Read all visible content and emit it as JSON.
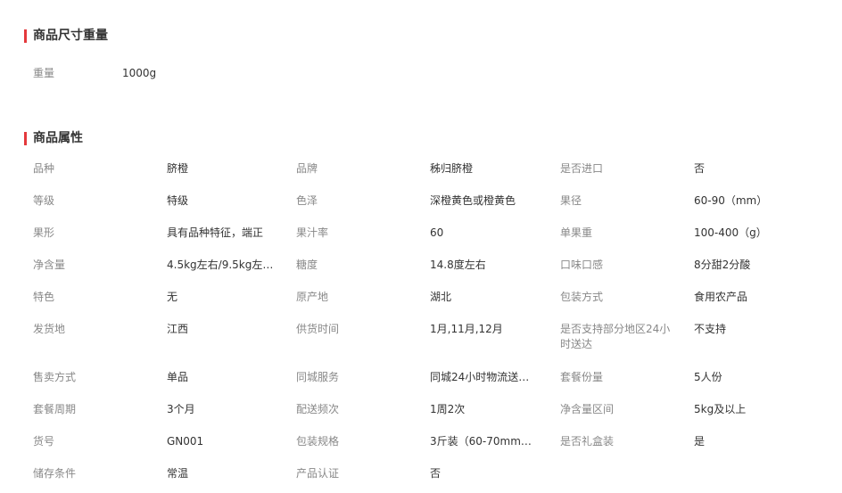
{
  "size_weight_section": {
    "title": "商品尺寸重量",
    "weight_label": "重量",
    "weight_value": "1000g"
  },
  "attributes_section": {
    "title": "商品属性",
    "rows": [
      [
        [
          "品种",
          "脐橙"
        ],
        [
          "品牌",
          "秭归脐橙"
        ],
        [
          "是否进口",
          "否"
        ]
      ],
      [
        [
          "等级",
          "特级"
        ],
        [
          "色泽",
          "深橙黄色或橙黄色"
        ],
        [
          "果径",
          "60-90（mm）"
        ]
      ],
      [
        [
          "果形",
          "具有品种特征，端正"
        ],
        [
          "果汁率",
          "60"
        ],
        [
          "单果重",
          "100-400（g）"
        ]
      ],
      [
        [
          "净含量",
          "4.5kg左右/9.5kg左右/..."
        ],
        [
          "糖度",
          "14.8度左右"
        ],
        [
          "口味口感",
          "8分甜2分酸"
        ]
      ],
      [
        [
          "特色",
          "无"
        ],
        [
          "原产地",
          "湖北"
        ],
        [
          "包装方式",
          "食用农产品"
        ]
      ],
      [
        [
          "发货地",
          "江西"
        ],
        [
          "供货时间",
          "1月,11月,12月"
        ],
        [
          "是否支持部分地区24小时送达",
          "不支持"
        ]
      ],
      [
        [
          "售卖方式",
          "单品"
        ],
        [
          "同城服务",
          "同城24小时物流送货..."
        ],
        [
          "套餐份量",
          "5人份"
        ]
      ],
      [
        [
          "套餐周期",
          "3个月"
        ],
        [
          "配送频次",
          "1周2次"
        ],
        [
          "净含量区间",
          "5kg及以上"
        ]
      ],
      [
        [
          "货号",
          "GN001"
        ],
        [
          "包装规格",
          "3斤装（60-70mm）..."
        ],
        [
          "是否礼盒装",
          "是"
        ]
      ],
      [
        [
          "储存条件",
          "常温"
        ],
        [
          "产品认证",
          "否"
        ]
      ]
    ]
  }
}
